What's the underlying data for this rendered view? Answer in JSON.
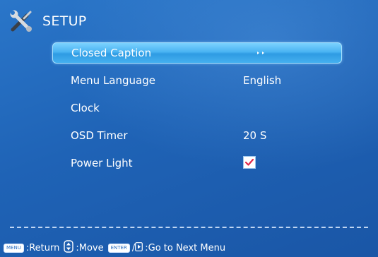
{
  "header": {
    "title": "SETUP",
    "icon": "tools-icon"
  },
  "menu": {
    "items": [
      {
        "label": "Closed Caption",
        "value": "",
        "selected": true,
        "indicator": "submenu-arrows"
      },
      {
        "label": "Menu Language",
        "value": "English"
      },
      {
        "label": "Clock",
        "value": ""
      },
      {
        "label": "OSD Timer",
        "value": "20 S"
      },
      {
        "label": "Power Light",
        "value": "",
        "checked": true
      }
    ]
  },
  "footer": {
    "menu_key": "MENU",
    "return_text": ":Return",
    "move_text": ":Move",
    "enter_key": "ENTER",
    "separator": "/",
    "next_text": ":Go to Next Menu"
  },
  "colors": {
    "background": "#1f63b6",
    "highlight": "#49b3f2",
    "check_mark": "#e0284a"
  }
}
